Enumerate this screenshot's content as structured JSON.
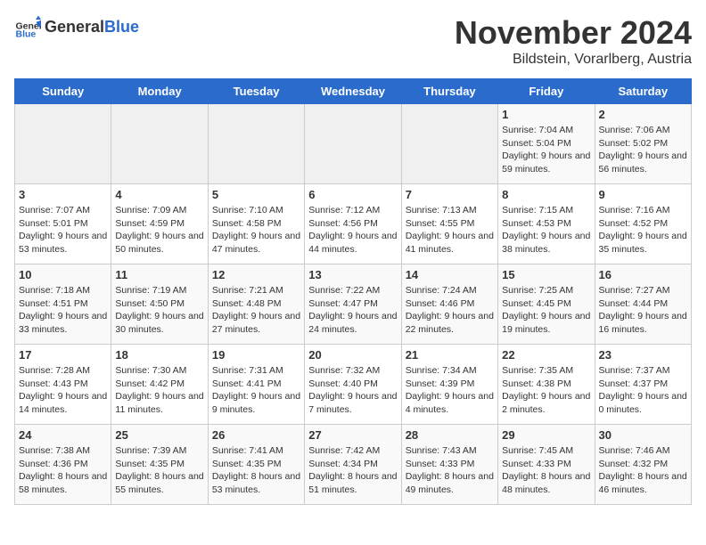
{
  "logo": {
    "general": "General",
    "blue": "Blue"
  },
  "title": "November 2024",
  "subtitle": "Bildstein, Vorarlberg, Austria",
  "days_of_week": [
    "Sunday",
    "Monday",
    "Tuesday",
    "Wednesday",
    "Thursday",
    "Friday",
    "Saturday"
  ],
  "weeks": [
    [
      {
        "day": "",
        "info": ""
      },
      {
        "day": "",
        "info": ""
      },
      {
        "day": "",
        "info": ""
      },
      {
        "day": "",
        "info": ""
      },
      {
        "day": "",
        "info": ""
      },
      {
        "day": "1",
        "info": "Sunrise: 7:04 AM\nSunset: 5:04 PM\nDaylight: 9 hours and 59 minutes."
      },
      {
        "day": "2",
        "info": "Sunrise: 7:06 AM\nSunset: 5:02 PM\nDaylight: 9 hours and 56 minutes."
      }
    ],
    [
      {
        "day": "3",
        "info": "Sunrise: 7:07 AM\nSunset: 5:01 PM\nDaylight: 9 hours and 53 minutes."
      },
      {
        "day": "4",
        "info": "Sunrise: 7:09 AM\nSunset: 4:59 PM\nDaylight: 9 hours and 50 minutes."
      },
      {
        "day": "5",
        "info": "Sunrise: 7:10 AM\nSunset: 4:58 PM\nDaylight: 9 hours and 47 minutes."
      },
      {
        "day": "6",
        "info": "Sunrise: 7:12 AM\nSunset: 4:56 PM\nDaylight: 9 hours and 44 minutes."
      },
      {
        "day": "7",
        "info": "Sunrise: 7:13 AM\nSunset: 4:55 PM\nDaylight: 9 hours and 41 minutes."
      },
      {
        "day": "8",
        "info": "Sunrise: 7:15 AM\nSunset: 4:53 PM\nDaylight: 9 hours and 38 minutes."
      },
      {
        "day": "9",
        "info": "Sunrise: 7:16 AM\nSunset: 4:52 PM\nDaylight: 9 hours and 35 minutes."
      }
    ],
    [
      {
        "day": "10",
        "info": "Sunrise: 7:18 AM\nSunset: 4:51 PM\nDaylight: 9 hours and 33 minutes."
      },
      {
        "day": "11",
        "info": "Sunrise: 7:19 AM\nSunset: 4:50 PM\nDaylight: 9 hours and 30 minutes."
      },
      {
        "day": "12",
        "info": "Sunrise: 7:21 AM\nSunset: 4:48 PM\nDaylight: 9 hours and 27 minutes."
      },
      {
        "day": "13",
        "info": "Sunrise: 7:22 AM\nSunset: 4:47 PM\nDaylight: 9 hours and 24 minutes."
      },
      {
        "day": "14",
        "info": "Sunrise: 7:24 AM\nSunset: 4:46 PM\nDaylight: 9 hours and 22 minutes."
      },
      {
        "day": "15",
        "info": "Sunrise: 7:25 AM\nSunset: 4:45 PM\nDaylight: 9 hours and 19 minutes."
      },
      {
        "day": "16",
        "info": "Sunrise: 7:27 AM\nSunset: 4:44 PM\nDaylight: 9 hours and 16 minutes."
      }
    ],
    [
      {
        "day": "17",
        "info": "Sunrise: 7:28 AM\nSunset: 4:43 PM\nDaylight: 9 hours and 14 minutes."
      },
      {
        "day": "18",
        "info": "Sunrise: 7:30 AM\nSunset: 4:42 PM\nDaylight: 9 hours and 11 minutes."
      },
      {
        "day": "19",
        "info": "Sunrise: 7:31 AM\nSunset: 4:41 PM\nDaylight: 9 hours and 9 minutes."
      },
      {
        "day": "20",
        "info": "Sunrise: 7:32 AM\nSunset: 4:40 PM\nDaylight: 9 hours and 7 minutes."
      },
      {
        "day": "21",
        "info": "Sunrise: 7:34 AM\nSunset: 4:39 PM\nDaylight: 9 hours and 4 minutes."
      },
      {
        "day": "22",
        "info": "Sunrise: 7:35 AM\nSunset: 4:38 PM\nDaylight: 9 hours and 2 minutes."
      },
      {
        "day": "23",
        "info": "Sunrise: 7:37 AM\nSunset: 4:37 PM\nDaylight: 9 hours and 0 minutes."
      }
    ],
    [
      {
        "day": "24",
        "info": "Sunrise: 7:38 AM\nSunset: 4:36 PM\nDaylight: 8 hours and 58 minutes."
      },
      {
        "day": "25",
        "info": "Sunrise: 7:39 AM\nSunset: 4:35 PM\nDaylight: 8 hours and 55 minutes."
      },
      {
        "day": "26",
        "info": "Sunrise: 7:41 AM\nSunset: 4:35 PM\nDaylight: 8 hours and 53 minutes."
      },
      {
        "day": "27",
        "info": "Sunrise: 7:42 AM\nSunset: 4:34 PM\nDaylight: 8 hours and 51 minutes."
      },
      {
        "day": "28",
        "info": "Sunrise: 7:43 AM\nSunset: 4:33 PM\nDaylight: 8 hours and 49 minutes."
      },
      {
        "day": "29",
        "info": "Sunrise: 7:45 AM\nSunset: 4:33 PM\nDaylight: 8 hours and 48 minutes."
      },
      {
        "day": "30",
        "info": "Sunrise: 7:46 AM\nSunset: 4:32 PM\nDaylight: 8 hours and 46 minutes."
      }
    ]
  ]
}
